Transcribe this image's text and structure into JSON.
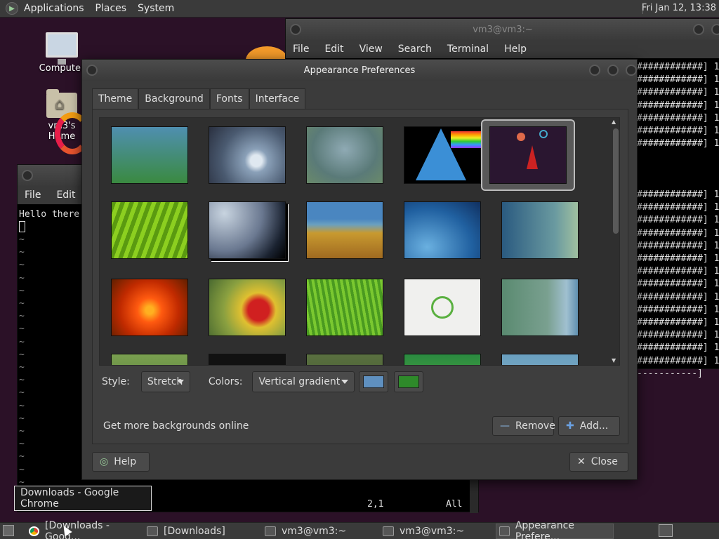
{
  "top_panel": {
    "menus": [
      "Applications",
      "Places",
      "System"
    ],
    "clock": "Fri Jan 12, 13:38"
  },
  "desktop": {
    "icons": [
      "Computer",
      "vm3's Home"
    ]
  },
  "terminal_window": {
    "title": "vm3@vm3:~",
    "menus": [
      "File",
      "Edit",
      "View",
      "Search",
      "Terminal",
      "Help"
    ],
    "lines": [
      "############] 1",
      "############] 1",
      "############] 1",
      "############] 1",
      "############] 1",
      "############] 1",
      "############] 1",
      "",
      "",
      "",
      "############] 1",
      "############] 1",
      "############] 1",
      "############] 1",
      "############] 1",
      "############] 1",
      "############] 1",
      "############] 1",
      "############] 1",
      "############] 1",
      "############] 1",
      "############] 1",
      "############] 1",
      "############] 1",
      "-----------]"
    ]
  },
  "vim_window": {
    "menus": [
      "File",
      "Edit"
    ],
    "first_line": "Hello there",
    "tilde": "~",
    "position": "2,1",
    "scroll": "All"
  },
  "appearance": {
    "title": "Appearance Preferences",
    "tabs": [
      "Theme",
      "Background",
      "Fonts",
      "Interface"
    ],
    "active_tab": "Background",
    "style_label": "Style:",
    "style_value": "Stretch",
    "colors_label": "Colors:",
    "colors_value": "Vertical gradient",
    "color1": "#5f90c0",
    "color2": "#2e8a2a",
    "get_more": "Get more backgrounds online",
    "remove": "Remove",
    "add": "Add...",
    "help": "Help",
    "close": "Close"
  },
  "tooltip": "Downloads - Google Chrome",
  "taskbar": {
    "items": [
      "[Downloads - Goog...",
      "[Downloads]",
      "vm3@vm3:~",
      "vm3@vm3:~",
      "Appearance Prefere..."
    ]
  }
}
